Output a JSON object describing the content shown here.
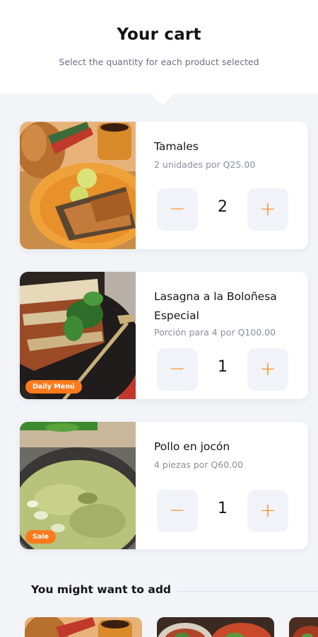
{
  "header": {
    "title": "Your cart",
    "subtitle": "Select the quantity for each product selected"
  },
  "items": [
    {
      "name": "Tamales",
      "description": "2 unidades por Q25.00",
      "quantity": "2",
      "badge": "",
      "image_icon": "tamales-photo"
    },
    {
      "name": "Lasagna a la Boloñesa Especial",
      "description": "Porción para 4 por Q100.00",
      "quantity": "1",
      "badge": "Daily Menú",
      "image_icon": "lasagna-photo"
    },
    {
      "name": "Pollo en jocón",
      "description": "4 piezas por Q60.00",
      "quantity": "1",
      "badge": "Sale",
      "image_icon": "pollo-jocon-photo"
    }
  ],
  "controls": {
    "minus": "−",
    "plus": "+"
  },
  "suggestions": {
    "title": "You might want to add",
    "items": [
      {
        "image_icon": "tamales-photo"
      },
      {
        "image_icon": "tacos-photo"
      },
      {
        "image_icon": "food-photo"
      }
    ]
  },
  "colors": {
    "accent": "#ff8a1e",
    "badge": "#ff7a1a",
    "background": "#f2f4f8",
    "button_bg": "#f1f3f8"
  }
}
